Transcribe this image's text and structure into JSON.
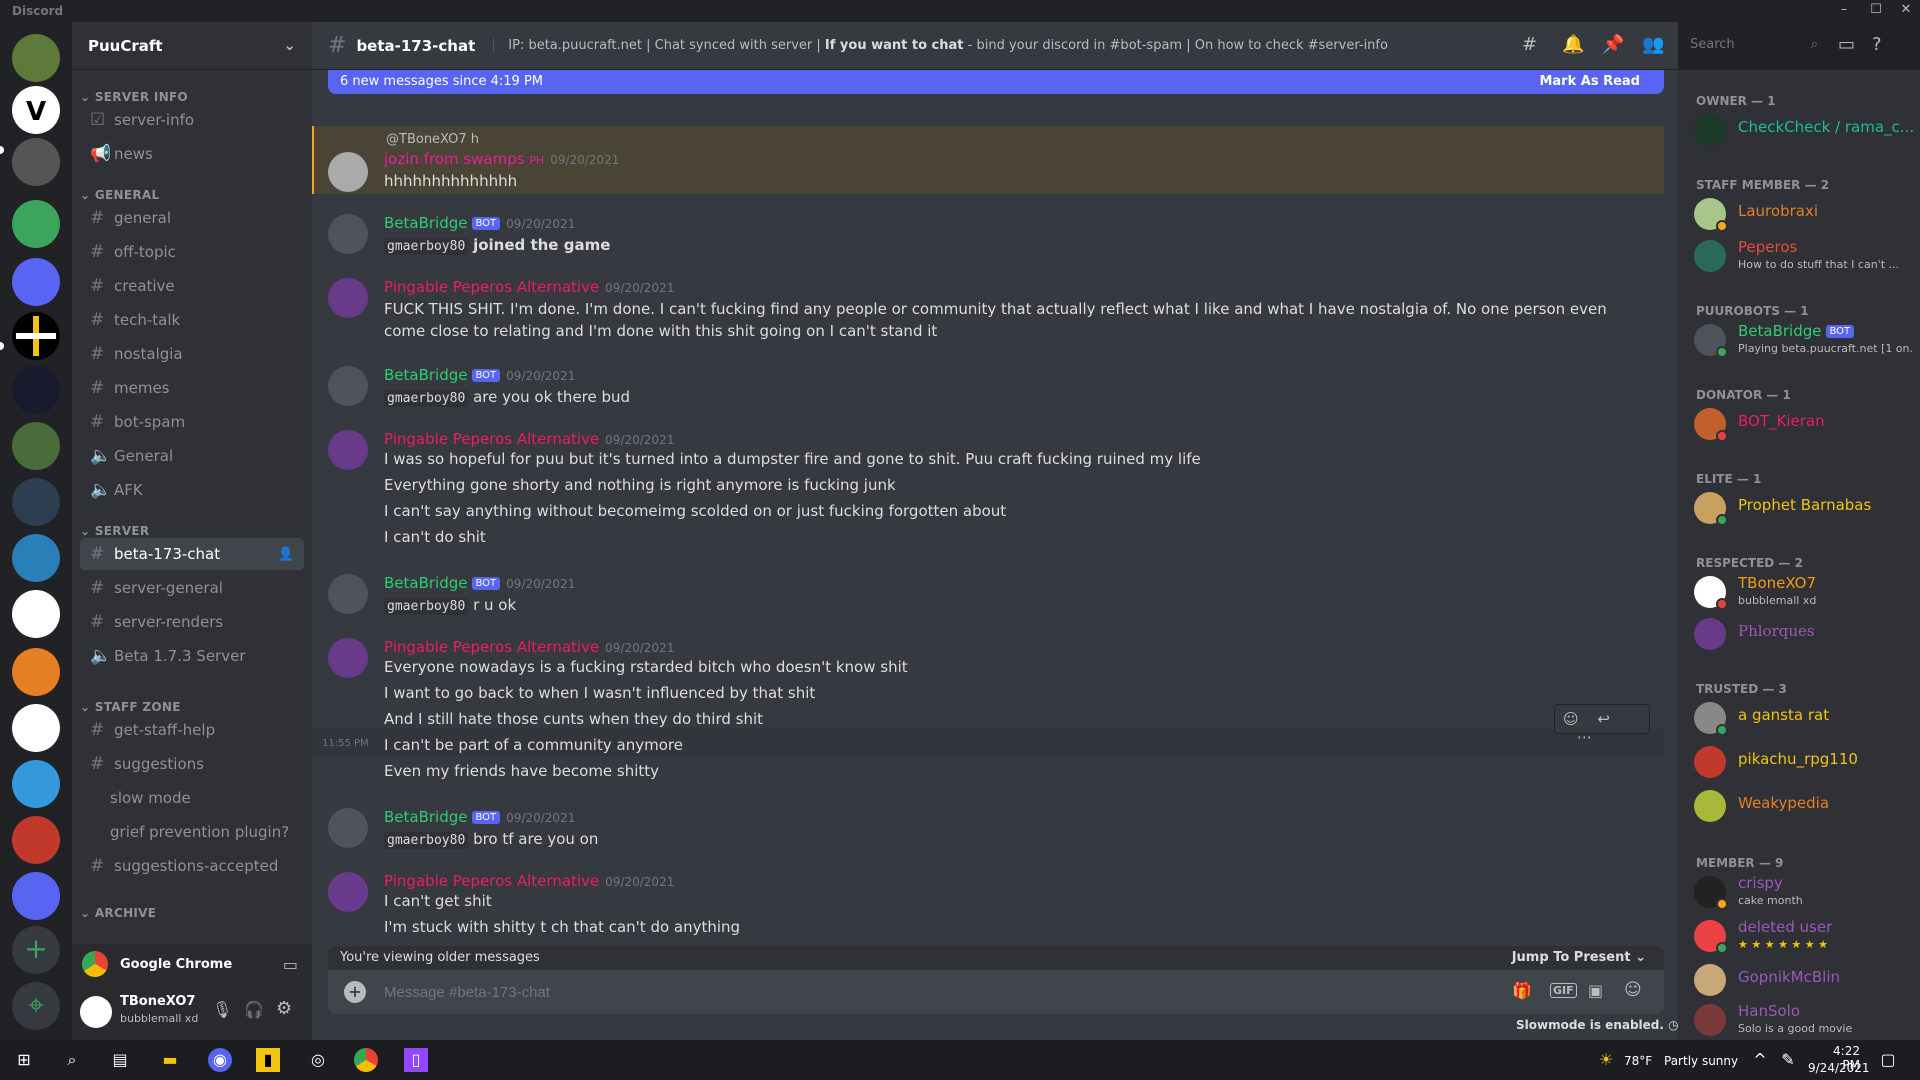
{
  "app": {
    "title": "Discord"
  },
  "server": {
    "name": "PuuCraft"
  },
  "channel_sidebar": {
    "categories": [
      {
        "name": "SERVER INFO"
      },
      {
        "name": "GENERAL"
      },
      {
        "name": "SERVER"
      },
      {
        "name": "STAFF ZONE"
      },
      {
        "name": "ARCHIVE"
      }
    ],
    "channels": [
      {
        "label": "server-info",
        "icon": "rules-icon"
      },
      {
        "label": "news",
        "icon": "announcement-icon"
      },
      {
        "label": "general",
        "icon": "hash-icon"
      },
      {
        "label": "off-topic",
        "icon": "hash-icon"
      },
      {
        "label": "creative",
        "icon": "hash-icon"
      },
      {
        "label": "tech-talk",
        "icon": "hash-icon"
      },
      {
        "label": "nostalgia",
        "icon": "hash-icon"
      },
      {
        "label": "memes",
        "icon": "hash-icon"
      },
      {
        "label": "bot-spam",
        "icon": "hash-icon"
      },
      {
        "label": "General",
        "icon": "speaker-icon"
      },
      {
        "label": "AFK",
        "icon": "speaker-icon"
      },
      {
        "label": "beta-173-chat",
        "icon": "hash-icon"
      },
      {
        "label": "server-general",
        "icon": "hash-icon"
      },
      {
        "label": "server-renders",
        "icon": "hash-icon"
      },
      {
        "label": "Beta 1.7.3 Server",
        "icon": "speaker-icon"
      },
      {
        "label": "get-staff-help",
        "icon": "hash-icon"
      },
      {
        "label": "suggestions",
        "icon": "threads-icon"
      },
      {
        "label": "slow mode",
        "icon": "thread-icon"
      },
      {
        "label": "grief prevention plugin?",
        "icon": "thread-icon"
      },
      {
        "label": "suggestions-accepted",
        "icon": "hash-icon"
      }
    ],
    "voice_activity": "Google Chrome",
    "user": {
      "name": "TBoneXO7",
      "status": "bubblemall xd"
    }
  },
  "chat": {
    "channel_name": "beta-173-chat",
    "topic_parts": [
      "IP: beta.puucraft.net | Chat synced with server | ",
      "If you want to chat",
      " - bind your discord in #bot-spam | On how to check #server-info"
    ],
    "search_placeholder": "Search",
    "new_messages": "6 new messages since 4:19 PM",
    "mark_as_read": "Mark As Read",
    "reply_ref": "@TBoneXO7 h",
    "messages": [
      {
        "author": "jozin from swamps",
        "tag": "PH",
        "time": "09/20/2021",
        "lines": [
          "hhhhhhhhhhhhhh"
        ]
      },
      {
        "author": "BetaBridge",
        "bot": "BOT",
        "time": "09/20/2021",
        "ign": "gmaerboy80",
        "lines": [
          "joined the game"
        ]
      },
      {
        "author": "Pingable Peperos Alternative",
        "time": "09/20/2021",
        "lines": [
          "FUCK THIS SHIT. I'm done. I'm done. I can't fucking find any people or community that actually reflect what I like and what I have nostalgia of. No one person even come close to relating and I'm done with this shit going on I can't stand it"
        ]
      },
      {
        "author": "BetaBridge",
        "bot": "BOT",
        "time": "09/20/2021",
        "ign": "gmaerboy80",
        "lines": [
          "are you ok there bud"
        ]
      },
      {
        "author": "Pingable Peperos Alternative",
        "time": "09/20/2021",
        "lines": [
          "I was so hopeful for puu but it's turned into a dumpster fire and gone to shit. Puu craft fucking ruined my life",
          "Everything gone shorty and nothing is right anymore is fucking junk",
          "I can't say anything without becomeimg scolded on or just fucking forgotten about",
          "I can't do shit"
        ]
      },
      {
        "author": "BetaBridge",
        "bot": "BOT",
        "time": "09/20/2021",
        "ign": "gmaerboy80",
        "lines": [
          "r u ok"
        ]
      },
      {
        "author": "Pingable Peperos Alternative",
        "time": "09/20/2021",
        "lines": [
          "Everyone nowadays is a fucking rstarded bitch who doesn't know shit",
          "I want to go back to when I wasn't influenced by that shit",
          "And I still hate those cunts when they do third shit",
          "I can't be part of a community anymore",
          "Even my friends have become shitty"
        ],
        "hover_time": "11:55 PM"
      },
      {
        "author": "BetaBridge",
        "bot": "BOT",
        "time": "09/20/2021",
        "ign": "gmaerboy80",
        "lines": [
          "bro tf are you on"
        ]
      },
      {
        "author": "Pingable Peperos Alternative",
        "time": "09/20/2021",
        "lines": [
          "I can't get shit",
          "I'm stuck with shitty t ch that can't do anything"
        ]
      }
    ],
    "viewing_older": "You're viewing older messages",
    "jump_to_present": "Jump To Present",
    "composer_placeholder": "Message #beta-173-chat",
    "slowmode": "Slowmode is enabled."
  },
  "members": {
    "groups": [
      {
        "title": "OWNER — 1",
        "members": [
          {
            "name": "CheckCheck / rama_c...",
            "color": "#1abc9c"
          }
        ]
      },
      {
        "title": "STAFF MEMBER — 2",
        "members": [
          {
            "name": "Laurobraxi",
            "color": "#e67e22"
          },
          {
            "name": "Peperos",
            "color": "#e74c3c",
            "activity": "How to do stuff that I can't ..."
          }
        ]
      },
      {
        "title": "PUUROBOTS — 1",
        "members": [
          {
            "name": "BetaBridge",
            "color": "#2ecc71",
            "bot": "BOT",
            "activity": "Playing beta.puucraft.net [1 on..."
          }
        ]
      },
      {
        "title": "DONATOR — 1",
        "members": [
          {
            "name": "BOT_Kieran",
            "color": "#e91e63"
          }
        ]
      },
      {
        "title": "ELITE — 1",
        "members": [
          {
            "name": "Prophet Barnabas",
            "color": "#f1c40f"
          }
        ]
      },
      {
        "title": "RESPECTED — 2",
        "members": [
          {
            "name": "TBoneXO7",
            "color": "#f39c12",
            "activity": "bubblemall xd"
          },
          {
            "name": "Phlorques",
            "color": "#9b59b6"
          }
        ]
      },
      {
        "title": "TRUSTED — 3",
        "members": [
          {
            "name": "a gansta rat",
            "color": "#f1c40f"
          },
          {
            "name": "pikachu_rpg110",
            "color": "#f1c40f"
          },
          {
            "name": "Weakypedia",
            "color": "#e67e22"
          }
        ]
      },
      {
        "title": "MEMBER — 9",
        "members": [
          {
            "name": "crispy",
            "color": "#9b59b6",
            "activity": "cake month"
          },
          {
            "name": "deleted user",
            "color": "#9b59b6",
            "activity": "★ ★ ★ ★ ★ ★ ★"
          },
          {
            "name": "GopnikMcBlin",
            "color": "#9b59b6"
          },
          {
            "name": "HanSolo",
            "color": "#9b59b6",
            "activity": "Solo is a good movie"
          }
        ]
      }
    ]
  },
  "taskbar": {
    "weather_temp": "78°F",
    "weather_desc": "Partly sunny",
    "time": "4:22 PM",
    "date": "9/24/2021"
  }
}
